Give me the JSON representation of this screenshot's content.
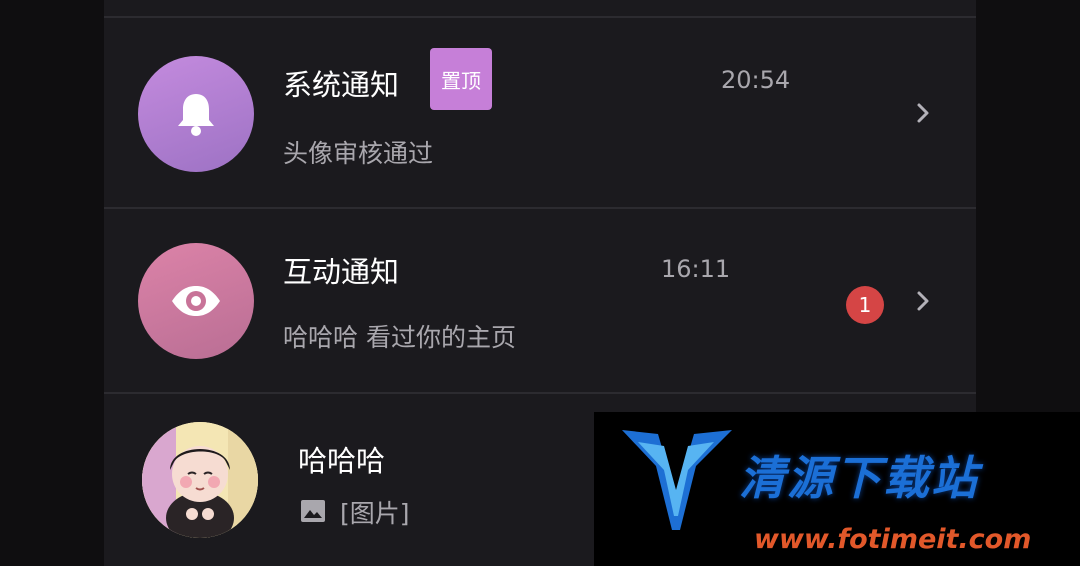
{
  "conversations": [
    {
      "title": "系统通知",
      "pin_label": "置顶",
      "time": "20:54",
      "preview": "头像审核通过",
      "avatar_icon": "bell-icon",
      "avatar_color": "#b07fd0"
    },
    {
      "title": "互动通知",
      "time": "16:11",
      "preview": "哈哈哈 看过你的主页",
      "unread_count": "1",
      "avatar_icon": "eye-icon",
      "avatar_color": "#d27aa0"
    },
    {
      "title": "哈哈哈",
      "preview_icon": "image-icon",
      "preview": "[图片]",
      "avatar_icon": "cartoon-boy-avatar"
    }
  ],
  "watermark": {
    "name": "清源下载站",
    "url": "www.fotimeit.com",
    "accent": "#1b6fd6",
    "url_color": "#e2582a"
  }
}
